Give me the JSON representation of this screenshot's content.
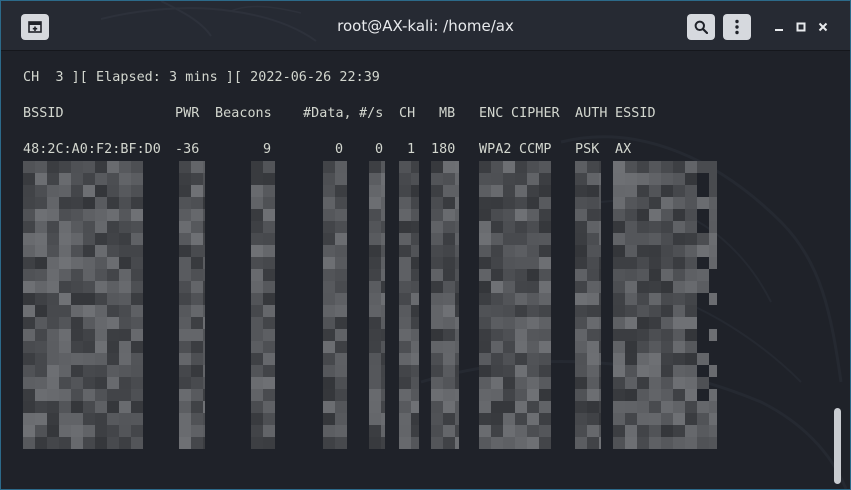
{
  "window": {
    "title": "root@AX-kali: /home/ax"
  },
  "terminal": {
    "status_line": "CH  3 ][ Elapsed: 3 mins ][ 2022-06-26 22:39",
    "headers": {
      "bssid": "BSSID",
      "pwr": "PWR",
      "beacons": "Beacons",
      "data": "#Data,",
      "rate": "#/s",
      "ch": "CH",
      "mb": "MB",
      "enc": "ENC",
      "cipher": "CIPHER",
      "auth": "AUTH",
      "essid": "ESSID"
    },
    "rows": [
      {
        "bssid": "48:2C:A0:F2:BF:D0",
        "pwr": "-36",
        "beacons": "9",
        "data": "0",
        "rate": "0",
        "ch": "1",
        "mb": "180",
        "enc": "WPA2",
        "cipher": "CCMP",
        "auth": "PSK",
        "essid": "AX"
      }
    ]
  },
  "icons": {
    "new_tab": "new-tab-icon",
    "search": "search-icon",
    "menu": "kebab-menu-icon",
    "minimize": "minimize-icon",
    "maximize": "maximize-icon",
    "close": "close-icon"
  },
  "colors": {
    "terminal_bg": "#1f2229",
    "titlebar_bg": "#262a33",
    "text": "#d3d7cf",
    "border": "#2c6a8a"
  }
}
